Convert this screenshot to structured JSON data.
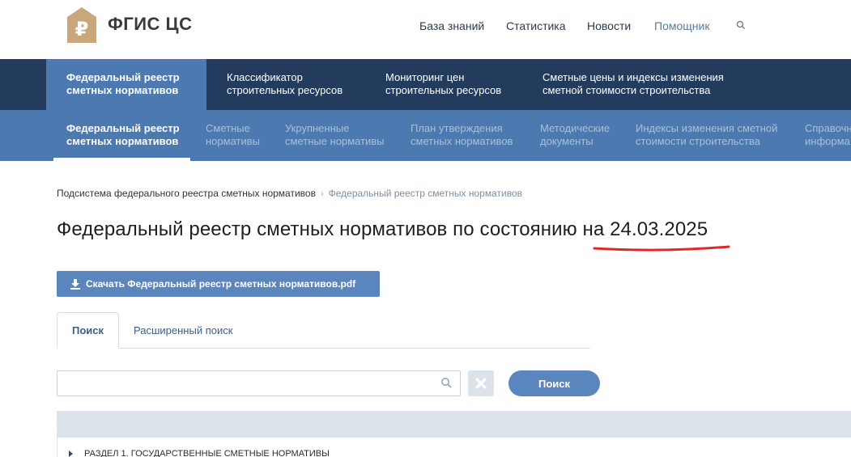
{
  "header": {
    "brand": "ФГИС ЦС",
    "logo_icon": "ruble-house-logo",
    "nav": [
      "База знаний",
      "Статистика",
      "Новости",
      "Помощник"
    ],
    "search_icon": "search-icon"
  },
  "primary_nav": [
    {
      "line1": "Федеральный реестр",
      "line2": "сметных нормативов",
      "active": true
    },
    {
      "line1": "Классификатор",
      "line2": "строительных ресурсов",
      "active": false
    },
    {
      "line1": "Мониторинг цен",
      "line2": "строительных ресурсов",
      "active": false
    },
    {
      "line1": "Сметные цены и индексы изменения",
      "line2": "сметной стоимости строительства",
      "active": false
    }
  ],
  "secondary_nav": [
    {
      "line1": "Федеральный реестр",
      "line2": "сметных нормативов",
      "active": true
    },
    {
      "line1": "Сметные",
      "line2": "нормативы",
      "active": false
    },
    {
      "line1": "Укрупненные",
      "line2": "сметные нормативы",
      "active": false
    },
    {
      "line1": "План утверждения",
      "line2": "сметных нормативов",
      "active": false
    },
    {
      "line1": "Методические",
      "line2": "документы",
      "active": false
    },
    {
      "line1": "Индексы изменения сметной",
      "line2": "стоимости строительства",
      "active": false
    },
    {
      "line1": "Справочн",
      "line2": "информа",
      "active": false
    }
  ],
  "breadcrumb": {
    "items": [
      "Подсистема федерального реестра сметных нормативов",
      "Федеральный реестр сметных нормативов"
    ],
    "separator": "›"
  },
  "page": {
    "title": "Федеральный реестр сметных нормативов по состоянию на 24.03.2025",
    "highlight_color": "#e0282b"
  },
  "download": {
    "label": "Скачать Федеральный реестр сметных нормативов.pdf",
    "icon": "download-icon"
  },
  "tabs": [
    {
      "label": "Поиск",
      "active": true
    },
    {
      "label": "Расширенный поиск",
      "active": false
    }
  ],
  "search": {
    "value": "",
    "placeholder": "",
    "submit_label": "Поиск",
    "clear_icon": "close-icon"
  },
  "results": {
    "rows": [
      {
        "label": "РАЗДЕЛ 1. ГОСУДАРСТВЕННЫЕ СМЕТНЫЕ НОРМАТИВЫ",
        "expanded": false
      }
    ]
  },
  "colors": {
    "nav_dark": "#233c5e",
    "nav_blue": "#4c79b0",
    "button": "#5b86bd",
    "logo": "#c9a77c"
  }
}
